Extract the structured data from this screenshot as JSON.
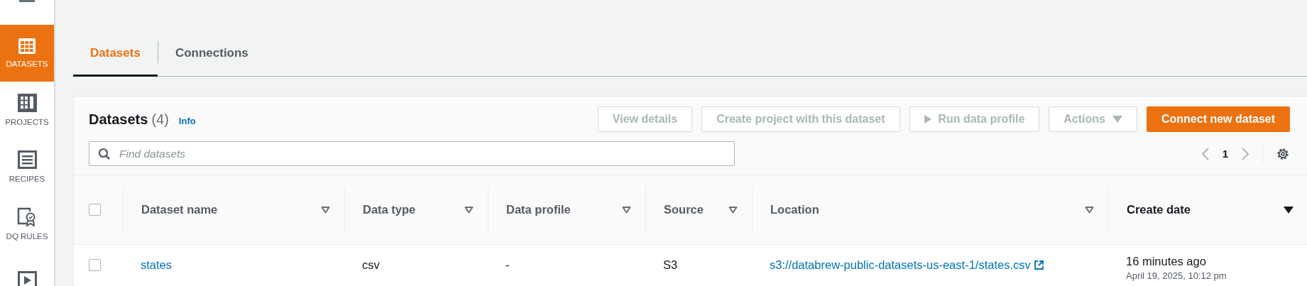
{
  "sidebar": {
    "items": [
      {
        "kind": "grid",
        "label": "DATASETS",
        "selected": true
      },
      {
        "kind": "projects",
        "label": "PROJECTS",
        "selected": false
      },
      {
        "kind": "list",
        "label": "RECIPES",
        "selected": false
      },
      {
        "kind": "rules",
        "label": "DQ RULES",
        "selected": false
      },
      {
        "kind": "play",
        "selected": false
      }
    ]
  },
  "tabs": [
    {
      "label": "Datasets",
      "selected": true
    },
    {
      "label": "Connections",
      "selected": false
    }
  ],
  "panel": {
    "title": "Datasets",
    "count": "(4)",
    "info": "Info",
    "buttons": [
      {
        "kind": "plain",
        "label": "View details",
        "disabled": true
      },
      {
        "kind": "plain",
        "label": "Create project with this dataset",
        "disabled": true
      },
      {
        "kind": "play",
        "label": "Run data profile",
        "disabled": true
      },
      {
        "kind": "dropdown",
        "label": "Actions",
        "disabled": true
      },
      {
        "kind": "primary",
        "label": "Connect new dataset",
        "disabled": false
      }
    ],
    "search": {
      "placeholder": "Find datasets"
    },
    "pagination": {
      "page": "1"
    }
  },
  "table": {
    "columns": [
      {
        "label": "Dataset name",
        "sorted": false
      },
      {
        "label": "Data type",
        "sorted": false
      },
      {
        "label": "Data profile",
        "sorted": false
      },
      {
        "label": "Source",
        "sorted": false
      },
      {
        "label": "Location",
        "sorted": false
      },
      {
        "label": "Create date",
        "sorted": true
      }
    ],
    "select_all": {
      "checked": false
    },
    "rows": [
      {
        "selected": false,
        "name": "states",
        "data_type": "csv",
        "data_profile": "-",
        "source": "S3",
        "location": "s3://databrew-public-datasets-us-east-1/states.csv",
        "created_relative": "16 minutes ago",
        "created": "April 19, 2025, 10:12 pm"
      }
    ]
  }
}
